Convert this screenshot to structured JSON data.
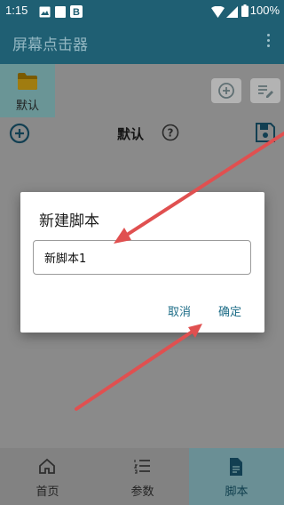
{
  "status_bar": {
    "time": "1:15",
    "battery": "100%"
  },
  "app_bar": {
    "title": "屏幕点击器",
    "more_icon": "more-vert-icon"
  },
  "folder_tab": {
    "label": "默认",
    "icon": "folder-icon"
  },
  "toolbar": {
    "title": "默认"
  },
  "dialog": {
    "title": "新建脚本",
    "input_value": "新脚本1",
    "cancel_label": "取消",
    "ok_label": "确定"
  },
  "bottom_nav": {
    "items": [
      {
        "label": "首页",
        "icon": "home-icon",
        "active": false
      },
      {
        "label": "参数",
        "icon": "list-icon",
        "active": false
      },
      {
        "label": "脚本",
        "icon": "document-icon",
        "active": true
      }
    ]
  },
  "colors": {
    "primary": "#1f5f73",
    "accent": "#1f6e88",
    "annotation_arrow": "#e05050"
  }
}
